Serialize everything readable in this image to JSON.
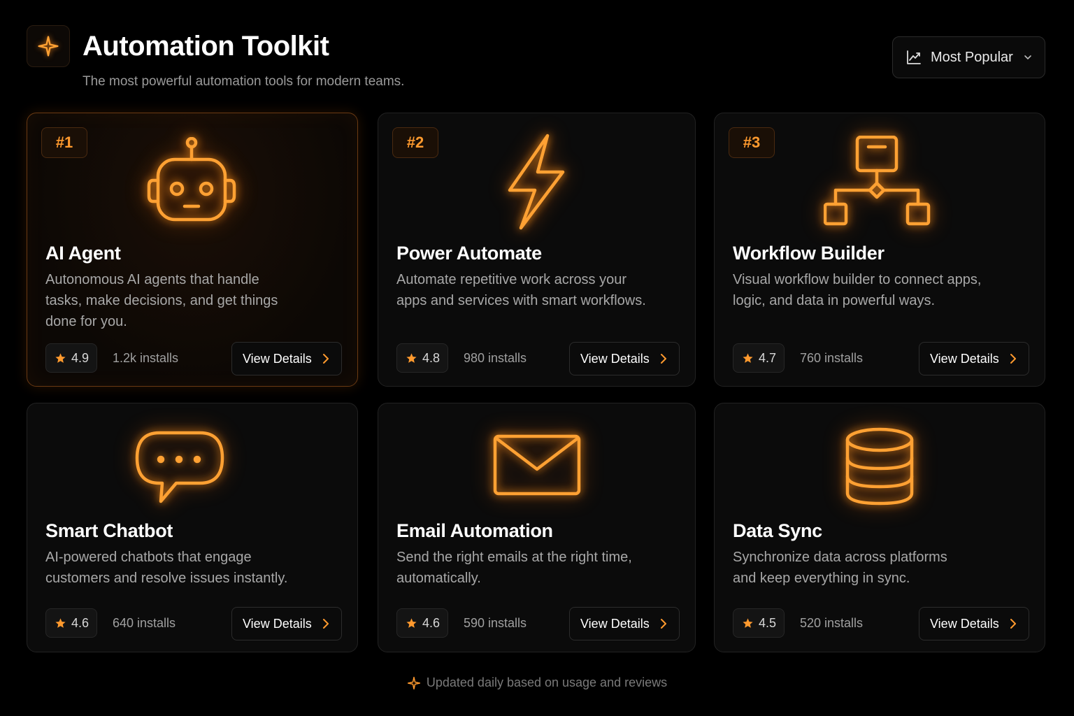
{
  "header": {
    "title": "Automation Toolkit",
    "subtitle": "The most powerful automation tools for modern teams.",
    "logo_icon": "sparkle-icon",
    "sort": {
      "label": "Most Popular",
      "icon": "trend-chart-icon"
    }
  },
  "cards": [
    {
      "rank": "#1",
      "title": "AI Agent",
      "icon": "robot-icon",
      "description_lines": [
        "Autonomous AI agents that handle",
        "tasks, make decisions, and get things",
        "done for you."
      ],
      "rating": "4.9",
      "installs": "1.2k installs",
      "button": "View Details"
    },
    {
      "rank": "#2",
      "title": "Power Automate",
      "icon": "lightning-icon",
      "description_lines": [
        "Automate repetitive work across your",
        "apps and services with smart workflows."
      ],
      "rating": "4.8",
      "installs": "980 installs",
      "button": "View Details"
    },
    {
      "rank": "#3",
      "title": "Workflow Builder",
      "icon": "workflow-icon",
      "description_lines": [
        "Visual workflow builder to connect apps,",
        "logic, and data in powerful ways."
      ],
      "rating": "4.7",
      "installs": "760 installs",
      "button": "View Details"
    },
    {
      "title": "Smart Chatbot",
      "icon": "chat-bubble-icon",
      "description_lines": [
        "AI-powered chatbots that engage",
        "customers and resolve issues instantly."
      ],
      "rating": "4.6",
      "installs": "640 installs",
      "button": "View Details"
    },
    {
      "title": "Email Automation",
      "icon": "envelope-icon",
      "description_lines": [
        "Send the right emails at the right time,",
        "automatically."
      ],
      "rating": "4.6",
      "installs": "590 installs",
      "button": "View Details"
    },
    {
      "title": "Data Sync",
      "icon": "database-icon",
      "description_lines": [
        "Synchronize data across platforms",
        "and keep everything in sync."
      ],
      "rating": "4.5",
      "installs": "520 installs",
      "button": "View Details"
    }
  ],
  "footer": {
    "text": "Updated daily based on usage and reviews",
    "icon": "sparkle-icon"
  },
  "colors": {
    "accent": "#ff9a2e",
    "background": "#000000",
    "card": "#0b0b0b"
  }
}
